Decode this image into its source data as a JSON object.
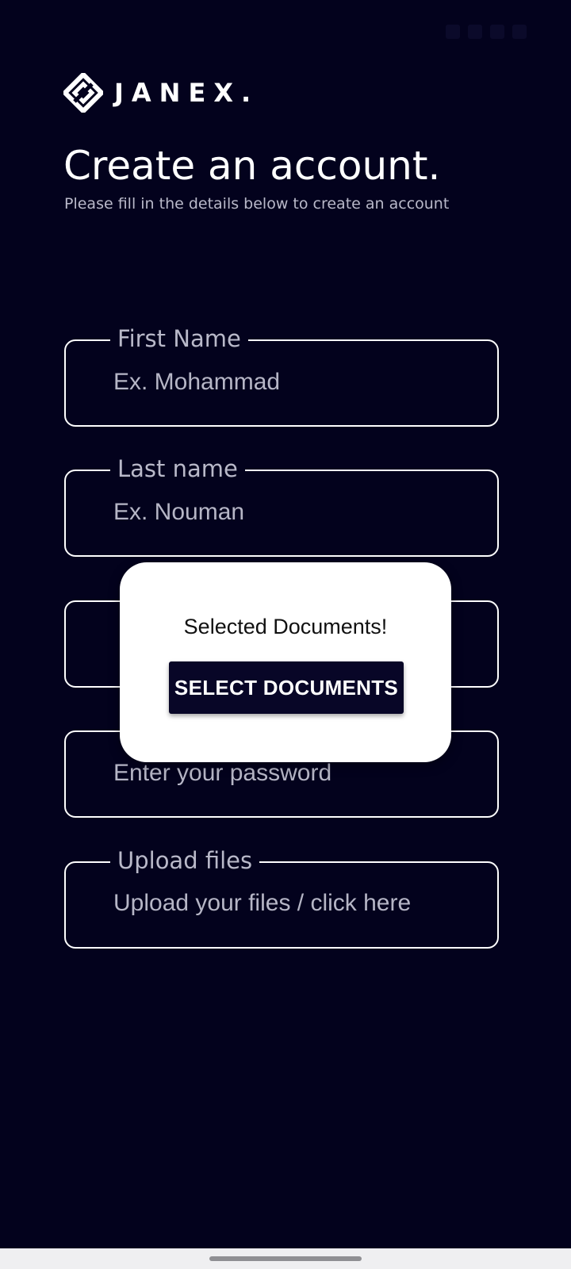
{
  "app": {
    "brand_name": "JANEX."
  },
  "header": {
    "title": "Create an account.",
    "subtitle": "Please fill in the details below to create an account"
  },
  "form": {
    "first_name": {
      "label": "First Name",
      "placeholder": "Ex. Mohammad"
    },
    "last_name": {
      "label": "Last name",
      "placeholder": "Ex. Nouman"
    },
    "email": {
      "label": "",
      "placeholder": ""
    },
    "password": {
      "label": "",
      "placeholder": "Enter your password"
    },
    "upload": {
      "label": "Upload files",
      "text": "Upload your files / click here"
    }
  },
  "dialog": {
    "message": "Selected Documents!",
    "button_label": "SELECT DOCUMENTS"
  },
  "colors": {
    "background": "#03021d",
    "field_border": "#ffffff",
    "label_text": "#b9b9c9",
    "dialog_background": "#ffffff",
    "dialog_button": "#080627"
  },
  "icons": {
    "logo": "janex-logo-icon",
    "status_bar": [
      "sim-icon",
      "wifi-icon",
      "signal-icon",
      "battery-icon"
    ]
  }
}
